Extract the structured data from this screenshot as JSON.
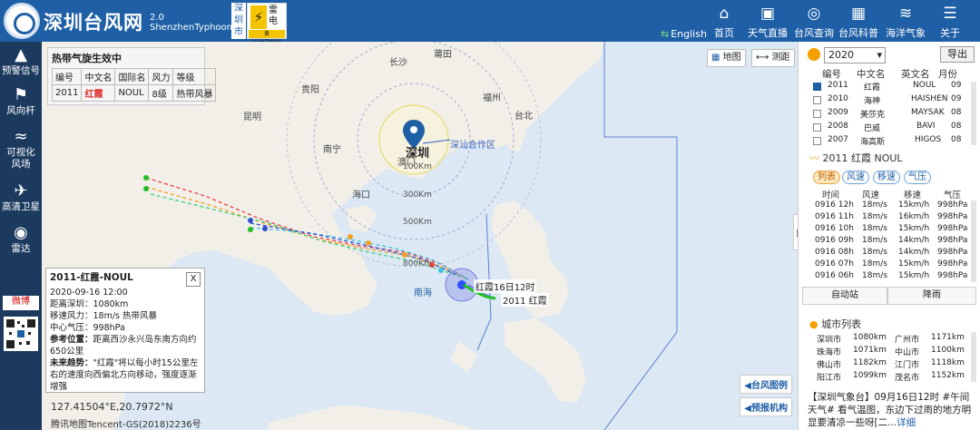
{
  "header": {
    "site_name": "深圳台风网",
    "version": "2.0",
    "sub_name": "ShenzhenTyphoon",
    "warn_region": "深圳市",
    "warn_text": "雷电",
    "warn_level": "黄",
    "warn_en": "LIGHTNING",
    "english": "English",
    "nav": [
      {
        "label": "首页",
        "icon": "home-icon"
      },
      {
        "label": "天气直播",
        "icon": "camera-icon"
      },
      {
        "label": "台风查询",
        "icon": "search-icon"
      },
      {
        "label": "台风科普",
        "icon": "chart-icon"
      },
      {
        "label": "海洋气象",
        "icon": "ocean-icon"
      },
      {
        "label": "关于",
        "icon": "menu-icon"
      }
    ]
  },
  "rail": [
    {
      "label": "预警信号",
      "icon": "warning-icon"
    },
    {
      "label": "风向杆",
      "icon": "windflag-icon"
    },
    {
      "label": "可视化风场",
      "icon": "wind-icon"
    },
    {
      "label": "高清卫星",
      "icon": "satellite-icon"
    },
    {
      "label": "雷达",
      "icon": "radar-icon"
    }
  ],
  "rail_social": {
    "weibo": "微博",
    "qr": "二维码"
  },
  "map": {
    "banner": {
      "title": "热带气旋生效中",
      "headers": [
        "编号",
        "中文名",
        "国际名",
        "风力",
        "等级"
      ],
      "row": [
        "2011",
        "红霞",
        "NOUL",
        "8级",
        "热带风暴"
      ]
    },
    "tool_map": "地图",
    "tool_measure": "测距",
    "cities": [
      "长沙",
      "莆田",
      "贵阳",
      "福州",
      "昆明",
      "台北",
      "南宁",
      "深圳",
      "澳门",
      "海口",
      "南海"
    ],
    "area_label": "深汕合作区",
    "rings": [
      "100Km",
      "300Km",
      "500Km",
      "800Km"
    ],
    "typhoon_label": "红霞16日12时",
    "typhoon_label2": "2011 红霞",
    "popup": {
      "title": "2011-红霞-NOUL",
      "close": "X",
      "time": "2020-09-16 12:00",
      "dist": "距离深圳：1080km",
      "wind": "移速风力：18m/s 热带风暴",
      "pressure": "中心气压：998hPa",
      "ref_label": "参考位置：",
      "ref": "距离西沙永兴岛东南方向约650公里",
      "trend_label": "未来趋势：",
      "trend": "\"红霞\"将以每小时15公里左右的速度向西偏北方向移动，强度逐渐增强"
    },
    "coords": "127.41504°E,20.7972°N",
    "copyright": "腾讯地图Tencent-GS(2018)2236号",
    "link1": "台风图例",
    "link2": "预报机构"
  },
  "panel": {
    "year": "2020",
    "export": "导出",
    "ty_headers": [
      "编号",
      "中文名",
      "英文名",
      "月份"
    ],
    "typhoons": [
      {
        "id": "2011",
        "cn": "红霞",
        "en": "NOUL",
        "m": "09",
        "checked": true
      },
      {
        "id": "2010",
        "cn": "海神",
        "en": "HAISHEN",
        "m": "09",
        "checked": false
      },
      {
        "id": "2009",
        "cn": "美莎克",
        "en": "MAYSAK",
        "m": "08",
        "checked": false
      },
      {
        "id": "2008",
        "cn": "巴威",
        "en": "BAVI",
        "m": "08",
        "checked": false
      },
      {
        "id": "2007",
        "cn": "海高斯",
        "en": "HIGOS",
        "m": "08",
        "checked": false
      }
    ],
    "selected": "2011 红霞 NOUL",
    "tabs": [
      "列表",
      "风速",
      "移速",
      "气压"
    ],
    "trk_headers": [
      "时间",
      "风速",
      "移速",
      "气压"
    ],
    "track": [
      {
        "t": "0916 12h",
        "w": "18m/s",
        "s": "15km/h",
        "p": "998hPa"
      },
      {
        "t": "0916 11h",
        "w": "18m/s",
        "s": "16km/h",
        "p": "998hPa"
      },
      {
        "t": "0916 10h",
        "w": "18m/s",
        "s": "15km/h",
        "p": "998hPa"
      },
      {
        "t": "0916 09h",
        "w": "18m/s",
        "s": "14km/h",
        "p": "998hPa"
      },
      {
        "t": "0916 08h",
        "w": "18m/s",
        "s": "14km/h",
        "p": "998hPa"
      },
      {
        "t": "0916 07h",
        "w": "18m/s",
        "s": "15km/h",
        "p": "998hPa"
      },
      {
        "t": "0916 06h",
        "w": "18m/s",
        "s": "15km/h",
        "p": "998hPa"
      }
    ],
    "btn_station": "自动站",
    "btn_rain": "降雨",
    "city_title": "城市列表",
    "city_dist": [
      [
        "深圳市",
        "1080km",
        "广州市",
        "1171km"
      ],
      [
        "珠海市",
        "1071km",
        "中山市",
        "1100km"
      ],
      [
        "佛山市",
        "1182km",
        "江门市",
        "1118km"
      ],
      [
        "阳江市",
        "1099km",
        "茂名市",
        "1152km"
      ]
    ],
    "news": "【深圳气象台】09月16日12时 #午间天气# 看气温图，东边下过雨的地方明显要清凉一些呀[二...",
    "news_more": "详细"
  }
}
